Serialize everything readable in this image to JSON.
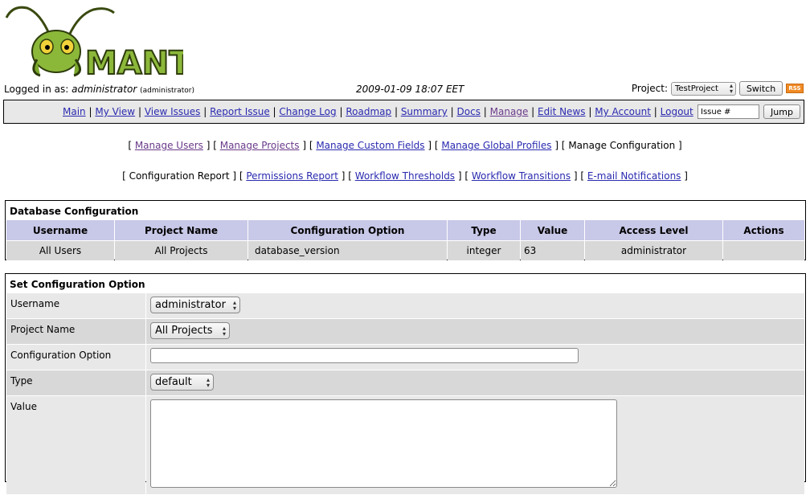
{
  "header": {
    "logo_text": "MANTIS",
    "logged_in_prefix": "Logged in as:",
    "username": "administrator",
    "user_role": "(administrator)",
    "datetime": "2009-01-09 18:07 EET",
    "project_label": "Project:",
    "project_selected": "TestProject",
    "switch_label": "Switch",
    "rss_label": "RSS"
  },
  "menu": {
    "items": [
      "Main",
      "My View",
      "View Issues",
      "Report Issue",
      "Change Log",
      "Roadmap",
      "Summary",
      "Docs",
      "Manage",
      "Edit News",
      "My Account",
      "Logout"
    ],
    "issue_placeholder": "Issue #",
    "jump_label": "Jump"
  },
  "manage_menu": {
    "items": [
      "Manage Users",
      "Manage Projects",
      "Manage Custom Fields",
      "Manage Global Profiles",
      "Manage Configuration"
    ]
  },
  "config_menu": {
    "items": [
      "Configuration Report",
      "Permissions Report",
      "Workflow Thresholds",
      "Workflow Transitions",
      "E-mail Notifications"
    ]
  },
  "db_config": {
    "title": "Database Configuration",
    "columns": [
      "Username",
      "Project Name",
      "Configuration Option",
      "Type",
      "Value",
      "Access Level",
      "Actions"
    ],
    "rows": [
      [
        "All Users",
        "All Projects",
        "database_version",
        "integer",
        "63",
        "administrator",
        ""
      ]
    ]
  },
  "set_config": {
    "title": "Set Configuration Option",
    "username_label": "Username",
    "username_value": "administrator",
    "project_label": "Project Name",
    "project_value": "All Projects",
    "option_label": "Configuration Option",
    "option_value": "",
    "type_label": "Type",
    "type_value": "default",
    "value_label": "Value",
    "value_value": ""
  }
}
